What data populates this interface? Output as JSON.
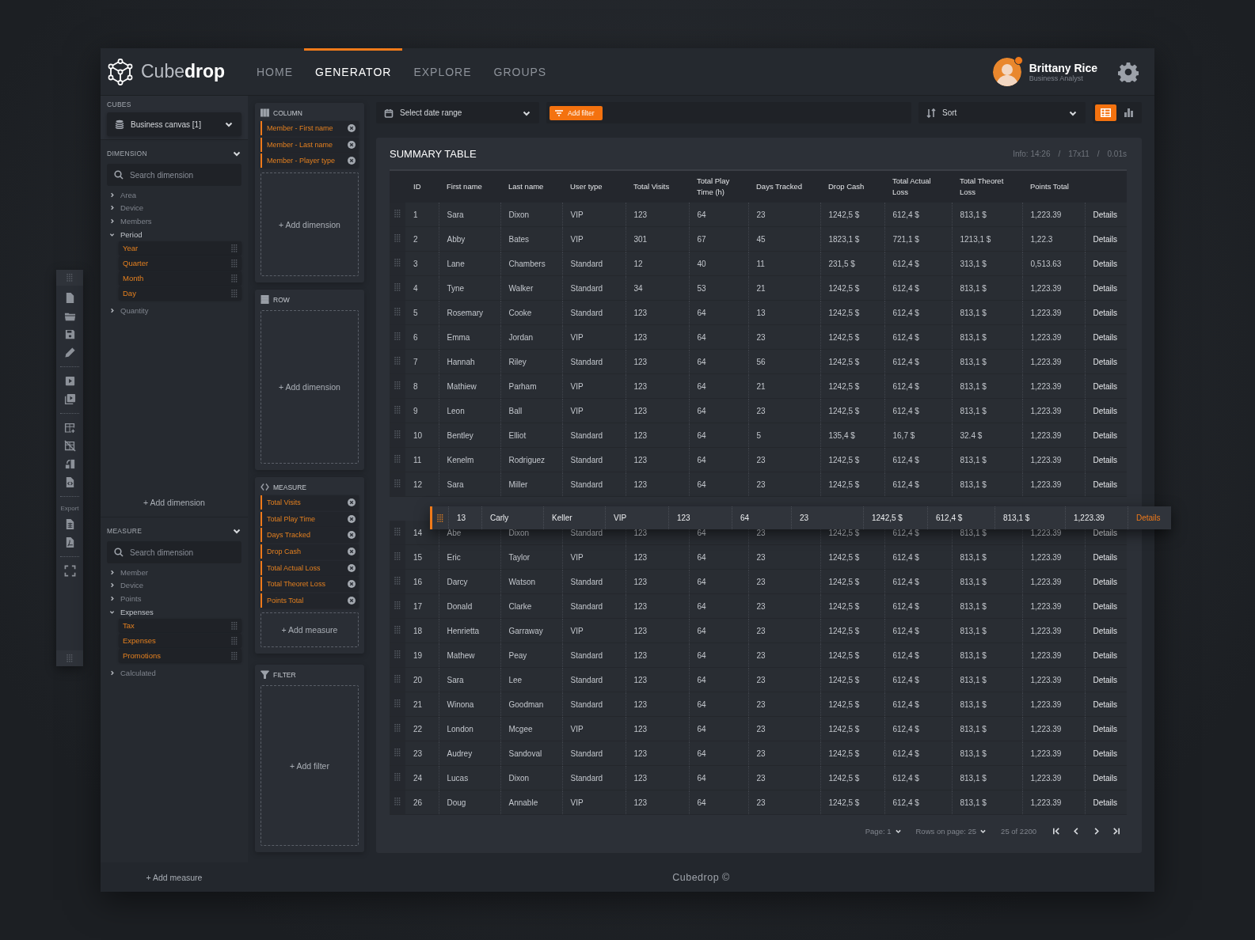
{
  "header": {
    "logo": "Cube**drop**",
    "nav": [
      {
        "label": "HOME",
        "selected": false
      },
      {
        "label": "GENERATOR",
        "selected": true
      },
      {
        "label": "EXPLORE",
        "selected": false
      },
      {
        "label": "GROUPS",
        "selected": false
      }
    ],
    "user": {
      "name": "Brittany Rice",
      "role": "Business Analyst",
      "online": true
    }
  },
  "tool_strip": {
    "export_label": "Export"
  },
  "sidebar": {
    "cubes": {
      "title": "CUBES",
      "value": "Business canvas [1]"
    },
    "dimension": {
      "title": "DIMENSION",
      "expanded": true,
      "placeholder": "Search dimension",
      "add": "+ Add dimension",
      "items": [
        {
          "label": "Area",
          "expanded": false
        },
        {
          "label": "Device",
          "expanded": false
        },
        {
          "label": "Members",
          "expanded": false
        },
        {
          "label": "Period",
          "expanded": true,
          "children": [
            {
              "label": "Year"
            },
            {
              "label": "Quarter"
            },
            {
              "label": "Month"
            },
            {
              "label": "Day"
            }
          ]
        },
        {
          "label": "Quantity",
          "expanded": false
        }
      ]
    },
    "measure": {
      "title": "MEASURE",
      "expanded": true,
      "placeholder": "Search dimension",
      "add": "+ Add measure",
      "items": [
        {
          "label": "Member",
          "expanded": false
        },
        {
          "label": "Device",
          "expanded": false
        },
        {
          "label": "Points",
          "expanded": false
        },
        {
          "label": "Expenses",
          "expanded": true,
          "children": [
            {
              "label": "Tax"
            },
            {
              "label": "Expenses"
            },
            {
              "label": "Promotions"
            }
          ]
        },
        {
          "label": "Calculated",
          "expanded": false
        }
      ]
    }
  },
  "builder": [
    {
      "kind": "column",
      "title": "COLUMN",
      "chips": [
        "Member - First name",
        "Member - Last name",
        "Member - Player type"
      ],
      "add": "+ Add dimension"
    },
    {
      "kind": "row",
      "title": "ROW",
      "add": "+ Add dimension"
    },
    {
      "kind": "measure",
      "title": "MEASURE",
      "chips": [
        "Total Visits",
        "Total Play Time",
        "Days Tracked",
        "Drop Cash",
        "Total Actual Loss",
        "Total Theoret Loss",
        "Points Total"
      ],
      "add": "+ Add measure"
    },
    {
      "kind": "filter",
      "title": "FILTER",
      "add": "+ Add filter"
    }
  ],
  "toolbar": {
    "date_range": "Select date range",
    "filter_button": "Add filter",
    "sort": "Sort",
    "views": [
      {
        "kind": "table",
        "selected": true
      },
      {
        "kind": "chart",
        "selected": false
      }
    ]
  },
  "summary": {
    "title": "SUMMARY TABLE",
    "info": [
      "Info: 14:26",
      "/",
      "17x11",
      "/",
      "0.01s"
    ],
    "columns": [
      "ID",
      "First name",
      "Last name",
      "User type",
      "Total Visits",
      "Total Play Time (h)",
      "Days Tracked",
      "Drop Cash",
      "Total Actual Loss",
      "Total Theoret Loss",
      "Points Total"
    ],
    "rows": [
      {
        "cells": [
          "1",
          "Sara",
          "Dixon",
          "VIP",
          "123",
          "64",
          "23",
          "1242,5 $",
          "612,4 $",
          "813,1 $",
          "1,223.39"
        ],
        "link": "Details"
      },
      {
        "cells": [
          "2",
          "Abby",
          "Bates",
          "VIP",
          "301",
          "67",
          "45",
          "1823,1 $",
          "721,1 $",
          "1213,1 $",
          "1,22.3"
        ],
        "link": "Details"
      },
      {
        "cells": [
          "3",
          "Lane",
          "Chambers",
          "Standard",
          "12",
          "40",
          "11",
          "231,5 $",
          "612,4 $",
          "313,1 $",
          "0,513.63"
        ],
        "link": "Details"
      },
      {
        "cells": [
          "4",
          "Tyne",
          "Walker",
          "Standard",
          "34",
          "53",
          "21",
          "1242,5 $",
          "612,4 $",
          "813,1 $",
          "1,223.39"
        ],
        "link": "Details"
      },
      {
        "cells": [
          "5",
          "Rosemary",
          "Cooke",
          "Standard",
          "123",
          "64",
          "13",
          "1242,5 $",
          "612,4 $",
          "813,1 $",
          "1,223.39"
        ],
        "link": "Details"
      },
      {
        "cells": [
          "6",
          "Emma",
          "Jordan",
          "VIP",
          "123",
          "64",
          "23",
          "1242,5 $",
          "612,4 $",
          "813,1 $",
          "1,223.39"
        ],
        "link": "Details"
      },
      {
        "cells": [
          "7",
          "Hannah",
          "Riley",
          "Standard",
          "123",
          "64",
          "56",
          "1242,5 $",
          "612,4 $",
          "813,1 $",
          "1,223.39"
        ],
        "link": "Details"
      },
      {
        "cells": [
          "8",
          "Mathiew",
          "Parham",
          "VIP",
          "123",
          "64",
          "21",
          "1242,5 $",
          "612,4 $",
          "813,1 $",
          "1,223.39"
        ],
        "link": "Details"
      },
      {
        "cells": [
          "9",
          "Leon",
          "Ball",
          "VIP",
          "123",
          "64",
          "23",
          "1242,5 $",
          "612,4 $",
          "813,1 $",
          "1,223.39"
        ],
        "link": "Details"
      },
      {
        "cells": [
          "10",
          "Bentley",
          "Elliot",
          "Standard",
          "123",
          "64",
          "5",
          "135,4 $",
          "16,7 $",
          "32.4 $",
          "1,223.39"
        ],
        "link": "Details"
      },
      {
        "cells": [
          "11",
          "Kenelm",
          "Rodriguez",
          "Standard",
          "123",
          "64",
          "23",
          "1242,5 $",
          "612,4 $",
          "813,1 $",
          "1,223.39"
        ],
        "link": "Details"
      },
      {
        "cells": [
          "12",
          "Sara",
          "Miller",
          "Standard",
          "123",
          "64",
          "23",
          "1242,5 $",
          "612,4 $",
          "813,1 $",
          "1,223.39"
        ],
        "link": "Details"
      },
      {
        "kind": "placeholder"
      },
      {
        "cells": [
          "14",
          "Abe",
          "Dixon",
          "Standard",
          "123",
          "64",
          "23",
          "1242,5 $",
          "612,4 $",
          "813,1 $",
          "1,223.39"
        ],
        "link": "Details"
      },
      {
        "cells": [
          "15",
          "Eric",
          "Taylor",
          "VIP",
          "123",
          "64",
          "23",
          "1242,5 $",
          "612,4 $",
          "813,1 $",
          "1,223.39"
        ],
        "link": "Details"
      },
      {
        "cells": [
          "16",
          "Darcy",
          "Watson",
          "Standard",
          "123",
          "64",
          "23",
          "1242,5 $",
          "612,4 $",
          "813,1 $",
          "1,223.39"
        ],
        "link": "Details"
      },
      {
        "cells": [
          "17",
          "Donald",
          "Clarke",
          "Standard",
          "123",
          "64",
          "23",
          "1242,5 $",
          "612,4 $",
          "813,1 $",
          "1,223.39"
        ],
        "link": "Details"
      },
      {
        "cells": [
          "18",
          "Henrietta",
          "Garraway",
          "VIP",
          "123",
          "64",
          "23",
          "1242,5 $",
          "612,4 $",
          "813,1 $",
          "1,223.39"
        ],
        "link": "Details"
      },
      {
        "cells": [
          "19",
          "Mathew",
          "Peay",
          "Standard",
          "123",
          "64",
          "23",
          "1242,5 $",
          "612,4 $",
          "813,1 $",
          "1,223.39"
        ],
        "link": "Details"
      },
      {
        "cells": [
          "20",
          "Sara",
          "Lee",
          "Standard",
          "123",
          "64",
          "23",
          "1242,5 $",
          "612,4 $",
          "813,1 $",
          "1,223.39"
        ],
        "link": "Details"
      },
      {
        "cells": [
          "21",
          "Winona",
          "Goodman",
          "Standard",
          "123",
          "64",
          "23",
          "1242,5 $",
          "612,4 $",
          "813,1 $",
          "1,223.39"
        ],
        "link": "Details"
      },
      {
        "cells": [
          "22",
          "London",
          "Mcgee",
          "VIP",
          "123",
          "64",
          "23",
          "1242,5 $",
          "612,4 $",
          "813,1 $",
          "1,223.39"
        ],
        "link": "Details"
      },
      {
        "cells": [
          "23",
          "Audrey",
          "Sandoval",
          "Standard",
          "123",
          "64",
          "23",
          "1242,5 $",
          "612,4 $",
          "813,1 $",
          "1,223.39"
        ],
        "link": "Details"
      },
      {
        "cells": [
          "24",
          "Lucas",
          "Dixon",
          "Standard",
          "123",
          "64",
          "23",
          "1242,5 $",
          "612,4 $",
          "813,1 $",
          "1,223.39"
        ],
        "link": "Details"
      },
      {
        "cells": [
          "26",
          "Doug",
          "Annable",
          "VIP",
          "123",
          "64",
          "23",
          "1242,5 $",
          "612,4 $",
          "813,1 $",
          "1,223.39"
        ],
        "link": "Details"
      }
    ],
    "drag_preview": {
      "cells": [
        "13",
        "Carly",
        "Keller",
        "VIP",
        "123",
        "64",
        "23",
        "1242,5 $",
        "612,4 $",
        "813,1 $",
        "1,223.39"
      ],
      "link": "Details"
    },
    "pagination": {
      "page": "Page: 1",
      "rows_per_page": "Rows on page: 25",
      "range": "25 of 2200"
    }
  },
  "footer": "Cubedrop ©"
}
